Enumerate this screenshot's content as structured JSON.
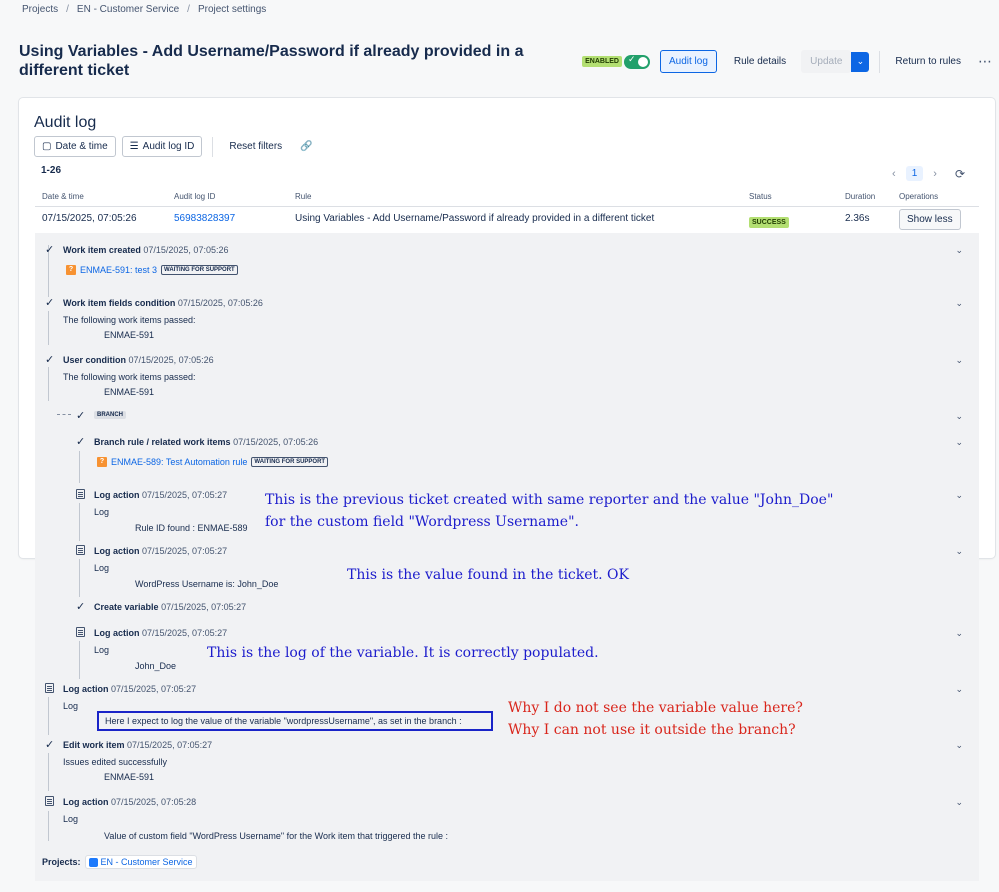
{
  "breadcrumbs": [
    "Projects",
    "EN - Customer Service",
    "Project settings"
  ],
  "page_title": "Using Variables - Add Username/Password if already provided in a different ticket",
  "header": {
    "enabled_badge": "ENABLED",
    "audit_log_btn": "Audit log",
    "rule_details_btn": "Rule details",
    "update_btn": "Update",
    "return_btn": "Return to rules",
    "more": "⋯"
  },
  "panel": {
    "title": "Audit log",
    "filters": {
      "date_time": "Date & time",
      "audit_log_id": "Audit log ID",
      "reset": "Reset filters"
    },
    "count": "1-26",
    "page": "1",
    "columns": [
      "Date & time",
      "Audit log ID",
      "Rule",
      "Status",
      "Duration",
      "Operations"
    ],
    "row": {
      "date": "07/15/2025, 07:05:26",
      "id": "56983828397",
      "rule": "Using Variables - Add Username/Password if already provided in a different ticket",
      "status": "SUCCESS",
      "duration": "2.36s",
      "operation": "Show less"
    }
  },
  "entries": {
    "e1": {
      "title": "Work item created",
      "ts": "07/15/2025, 07:05:26",
      "link": "ENMAE-591: test 3",
      "badge": "WAITING FOR SUPPORT"
    },
    "e2": {
      "title": "Work item fields condition",
      "ts": "07/15/2025, 07:05:26",
      "line1": "The following work items passed:",
      "line2": "ENMAE-591"
    },
    "e3": {
      "title": "User condition",
      "ts": "07/15/2025, 07:05:26",
      "line1": "The following work items passed:",
      "line2": "ENMAE-591"
    },
    "branch": "BRANCH",
    "e4": {
      "title": "Branch rule / related work items",
      "ts": "07/15/2025, 07:05:26",
      "link": "ENMAE-589: Test Automation rule",
      "badge": "WAITING FOR SUPPORT"
    },
    "e5": {
      "title": "Log action",
      "ts": "07/15/2025, 07:05:27",
      "line1": "Log",
      "line2": "Rule ID found : ENMAE-589"
    },
    "e6": {
      "title": "Log action",
      "ts": "07/15/2025, 07:05:27",
      "line1": "Log",
      "line2": "WordPress Username is: John_Doe"
    },
    "e7": {
      "title": "Create variable",
      "ts": "07/15/2025, 07:05:27"
    },
    "e8": {
      "title": "Log action",
      "ts": "07/15/2025, 07:05:27",
      "line1": "Log",
      "line2": "John_Doe"
    },
    "e9": {
      "title": "Log action",
      "ts": "07/15/2025, 07:05:27",
      "line1": "Log",
      "line2": "Here I expect to log the value of the variable \"wordpressUsername\", as set in the branch :"
    },
    "e10": {
      "title": "Edit work item",
      "ts": "07/15/2025, 07:05:27",
      "line1": "Issues edited successfully",
      "line2": "ENMAE-591"
    },
    "e11": {
      "title": "Log action",
      "ts": "07/15/2025, 07:05:28",
      "line1": "Log",
      "line2": "Value of custom field \"WordPress Username\" for the Work item that triggered the rule :"
    }
  },
  "projects": {
    "label": "Projects:",
    "name": "EN - Customer Service"
  },
  "annotations": {
    "a1_l1": "This is the previous ticket created with same reporter and the value \"John_Doe\"",
    "a1_l2": "for the custom field \"Wordpress Username\".",
    "a2": "This is the value found in the ticket. OK",
    "a3": "This is the log of the variable. It is correctly populated.",
    "a4_l1": "Why I do not see the variable value here?",
    "a4_l2": "Why I can not use it outside the branch?"
  }
}
